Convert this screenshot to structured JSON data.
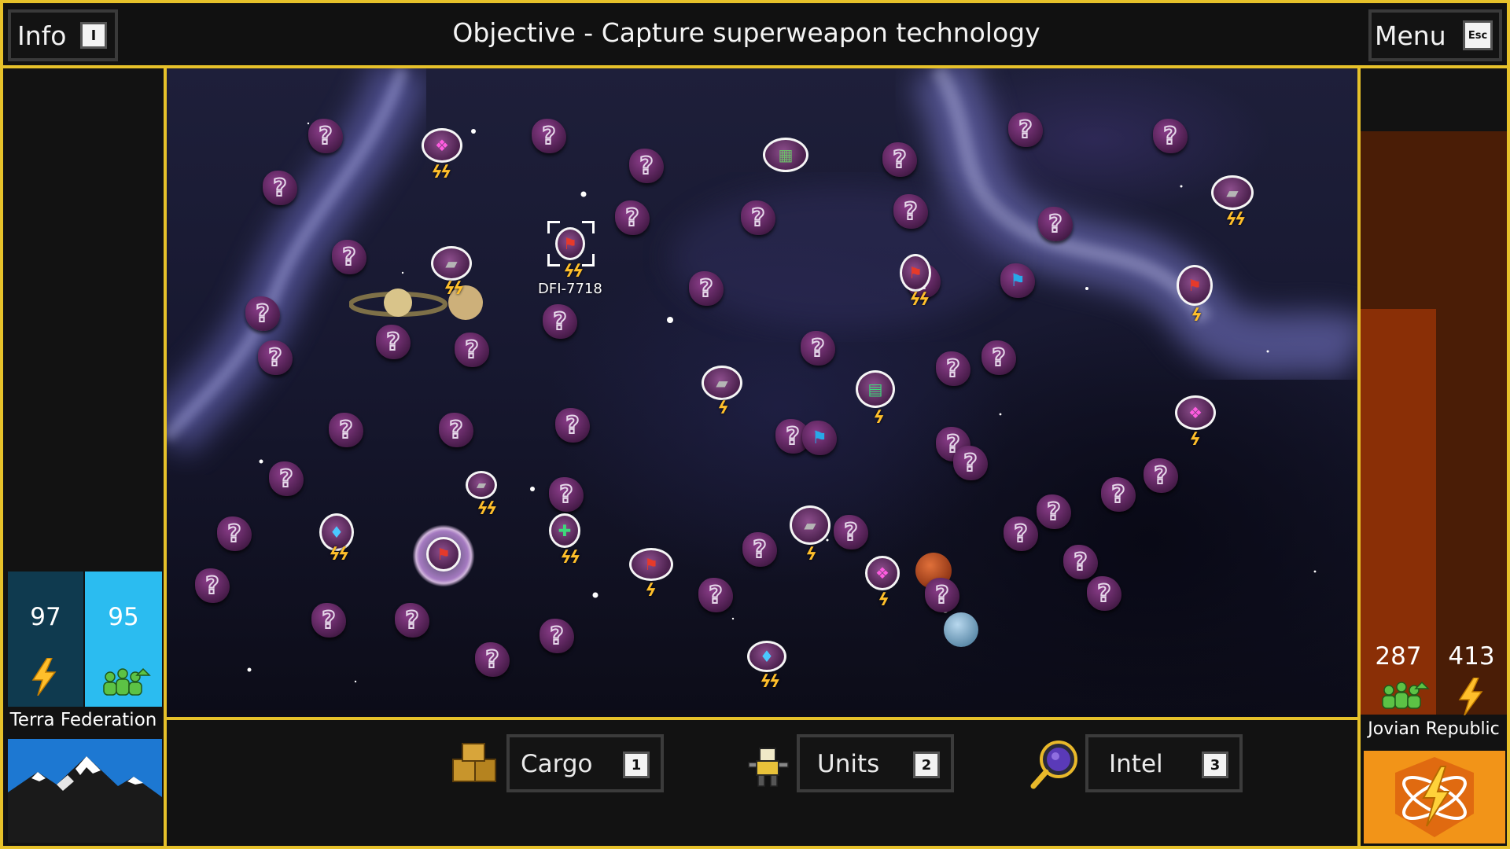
{
  "header": {
    "info_label": "Info",
    "info_key": "I",
    "objective": "Objective  -  Capture superweapon technology",
    "menu_label": "Menu",
    "menu_key": "Esc"
  },
  "player_faction": {
    "name": "Terra Federation",
    "energy": "97",
    "population": "95",
    "colors": {
      "energy_bar": "#0f3a4f",
      "population_bar": "#2bbcf0"
    }
  },
  "enemy_faction": {
    "name": "Jovian Republic",
    "population": "287",
    "energy": "413",
    "colors": {
      "population_bar": "#8a2f06",
      "energy_bar": "#4a1d06",
      "emblem_bg": "#f29418"
    }
  },
  "map": {
    "selected_node_label": "DFI-7718"
  },
  "bottom_bar": {
    "tabs": [
      {
        "label": "Cargo",
        "key": "1",
        "icon": "cargo-crates-icon"
      },
      {
        "label": "Units",
        "key": "2",
        "icon": "units-mech-icon"
      },
      {
        "label": "Intel",
        "key": "3",
        "icon": "intel-magnifier-icon"
      }
    ]
  },
  "colors": {
    "frame": "#e6c12a",
    "energy_bolt": "#ffbf2b",
    "asteroid": "#7a3478"
  }
}
